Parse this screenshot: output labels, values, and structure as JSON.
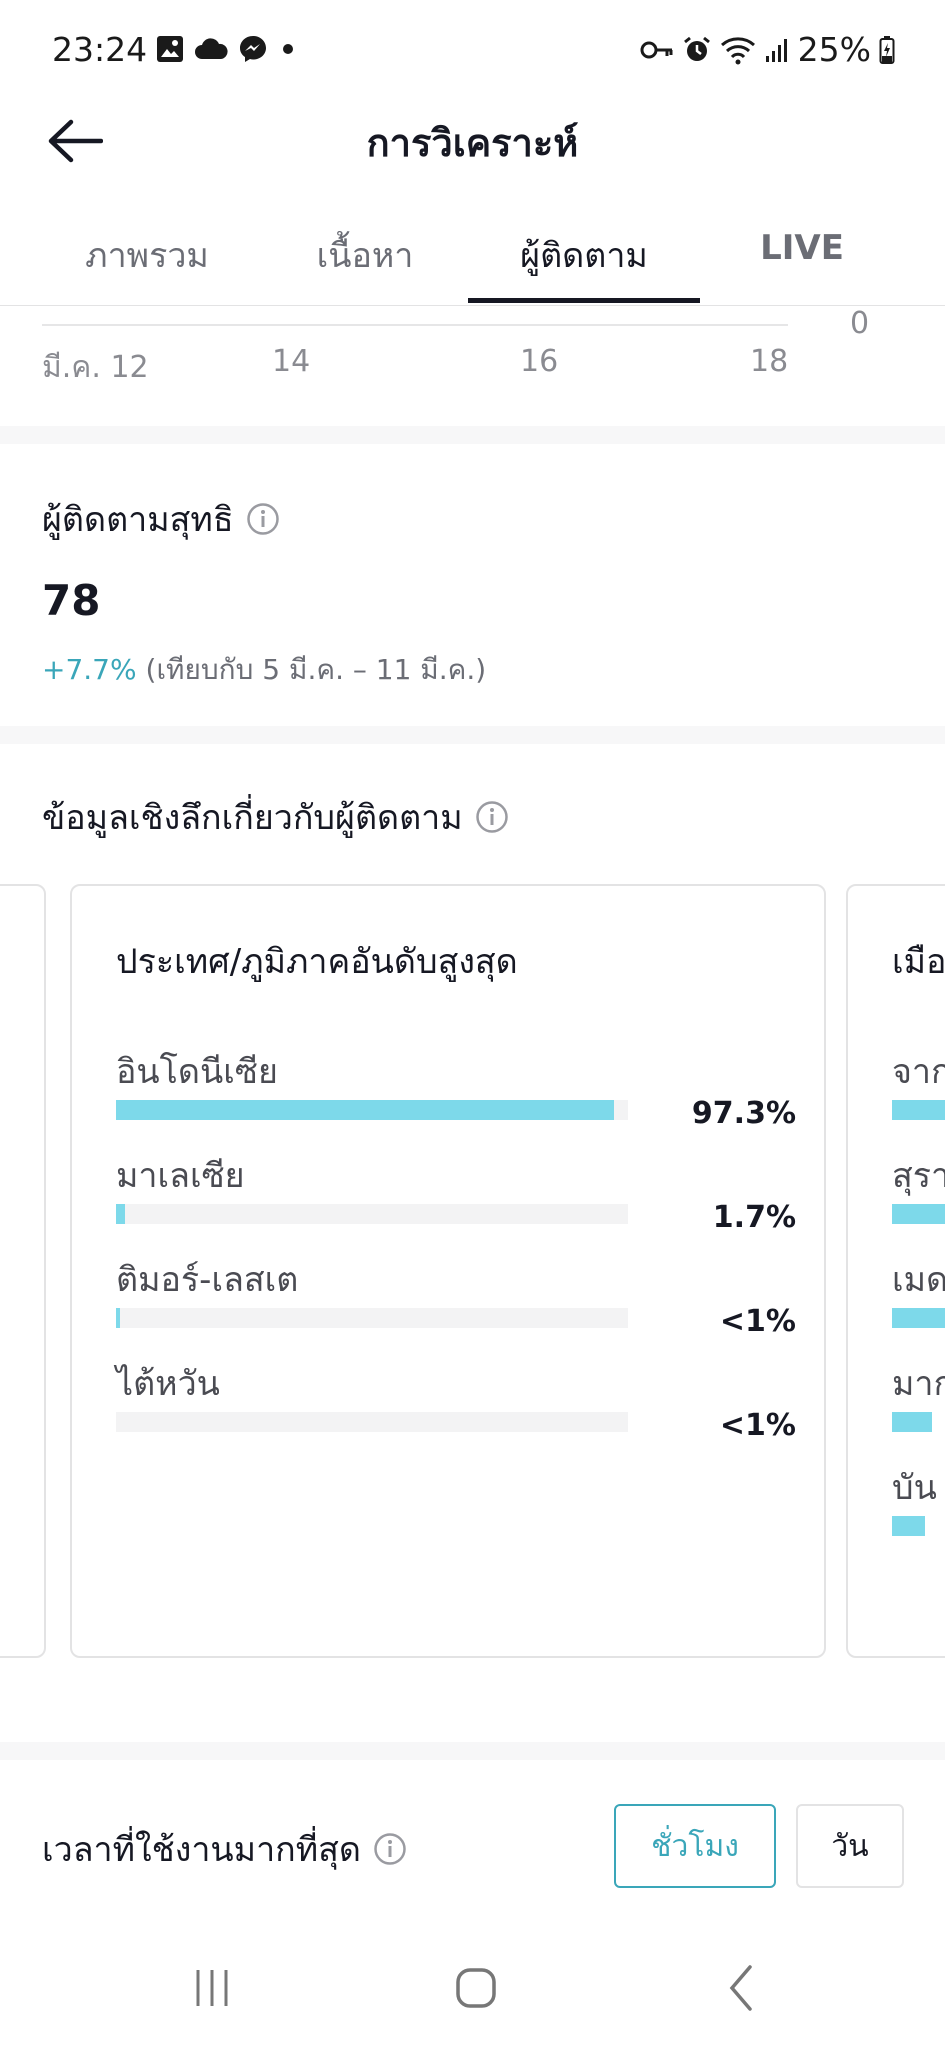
{
  "status_bar": {
    "time": "23:24",
    "battery": "25%",
    "icons_left": [
      "image-icon",
      "cloud-icon",
      "messenger-icon",
      "dot-icon"
    ],
    "icons_right": [
      "key-icon",
      "alarm-icon",
      "wifi-icon",
      "signal-icon",
      "battery-icon"
    ]
  },
  "header": {
    "title": "การวิเคราะห์"
  },
  "tabs": [
    {
      "label": "ภาพรวม",
      "active": false
    },
    {
      "label": "เนื้อหา",
      "active": false
    },
    {
      "label": "ผู้ติดตาม",
      "active": true
    },
    {
      "label": "LIVE",
      "active": false
    }
  ],
  "chart_axis": {
    "ticks": [
      "มี.ค. 12",
      "14",
      "16",
      "18"
    ],
    "y_zero": "0"
  },
  "net_followers": {
    "title": "ผู้ติดตามสุทธิ",
    "value": "78",
    "change": "+7.7%",
    "comparison": "(เทียบกับ 5 มี.ค. – 11 มี.ค.)"
  },
  "insights": {
    "title": "ข้อมูลเชิงลึกเกี่ยวกับผู้ติดตาม",
    "top_countries": {
      "title": "ประเทศ/ภูมิภาคอันดับสูงสุด",
      "rows": [
        {
          "label": "อินโดนีเซีย",
          "pct": "97.3%",
          "fill": 0.973
        },
        {
          "label": "มาเลเซีย",
          "pct": "1.7%",
          "fill": 0.017
        },
        {
          "label": "ติมอร์-เลสเต",
          "pct": "<1%",
          "fill": 0.006
        },
        {
          "label": "ไต้หวัน",
          "pct": "<1%",
          "fill": 0.0
        }
      ]
    },
    "top_cities_partial": {
      "title": "เมือ",
      "rows": [
        {
          "label": "จาก",
          "fill": 1.0
        },
        {
          "label": "สุรา",
          "fill": 1.0
        },
        {
          "label": "เมด",
          "fill": 1.0
        },
        {
          "label": "มาก",
          "fill": 0.36
        },
        {
          "label": "บัน",
          "fill": 0.3
        }
      ]
    }
  },
  "active_times": {
    "title": "เวลาที่ใช้งานมากที่สุด",
    "hour_label": "ชั่วโมง",
    "day_label": "วัน"
  },
  "colors": {
    "accent": "#3aa6b9",
    "bar": "#7dd9ea",
    "track": "#f3f3f4",
    "text": "#161823",
    "muted": "#6b6d75"
  }
}
